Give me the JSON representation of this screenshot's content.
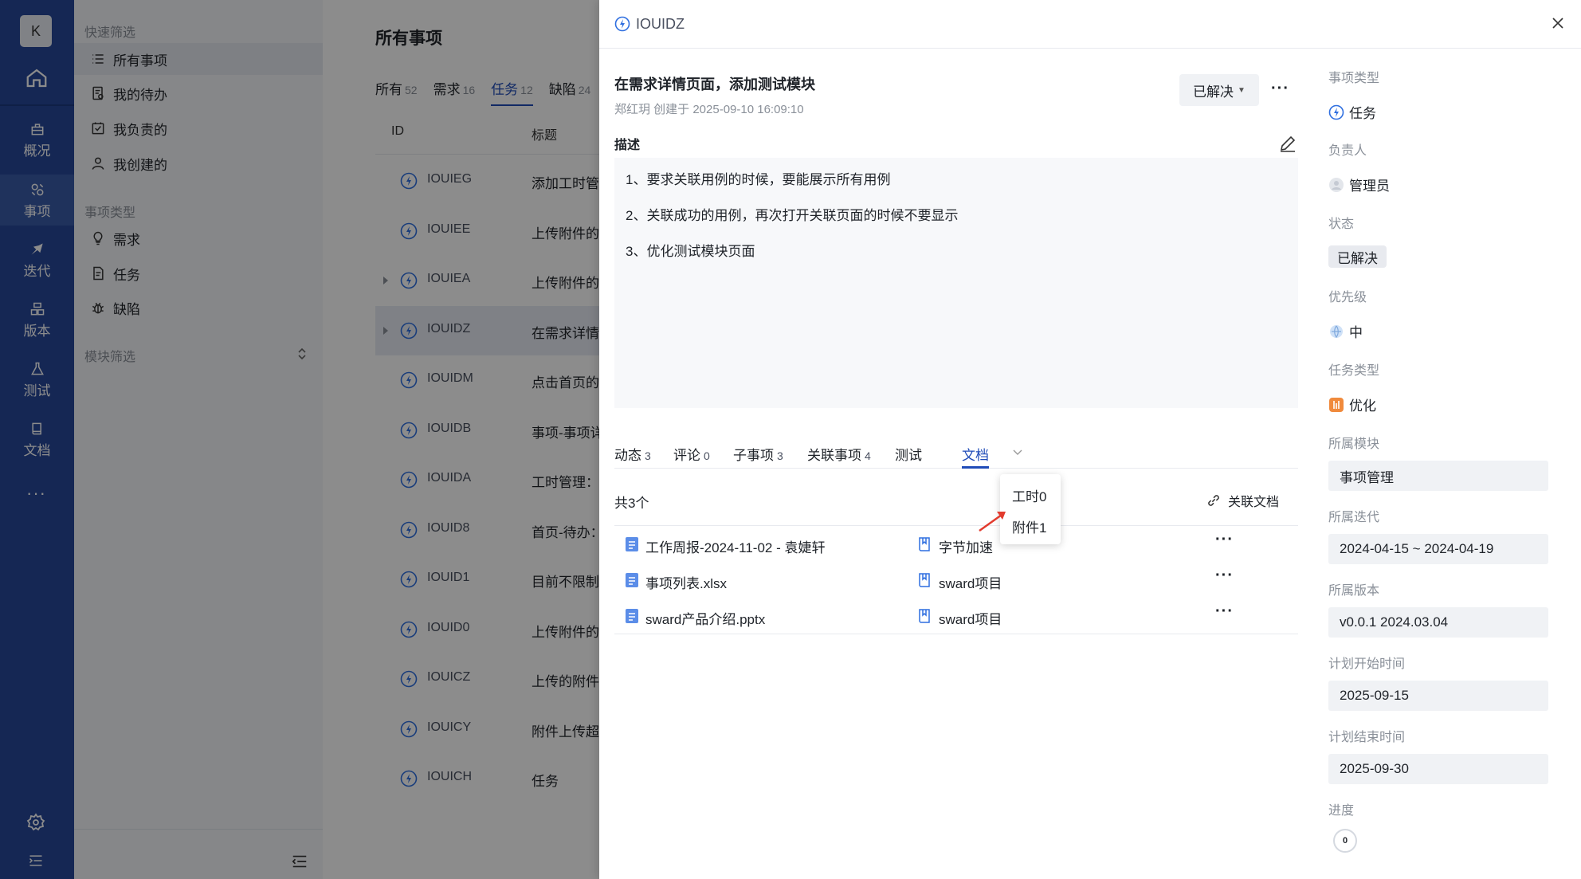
{
  "rail": {
    "avatar": "K",
    "items": [
      {
        "label": "概况",
        "icon": "overview-icon"
      },
      {
        "label": "事项",
        "icon": "workitem-icon"
      },
      {
        "label": "迭代",
        "icon": "sprint-icon"
      },
      {
        "label": "版本",
        "icon": "version-icon"
      },
      {
        "label": "测试",
        "icon": "test-icon"
      },
      {
        "label": "文档",
        "icon": "doc-icon"
      }
    ],
    "more": "···"
  },
  "sidebar": {
    "quick_filter_title": "快速筛选",
    "quick_filters": [
      "所有事项",
      "我的待办",
      "我负责的",
      "我创建的"
    ],
    "type_title": "事项类型",
    "types": [
      "需求",
      "任务",
      "缺陷"
    ],
    "module_title": "模块筛选"
  },
  "list": {
    "title": "所有事项",
    "tabs": [
      {
        "label": "所有",
        "count": "52"
      },
      {
        "label": "需求",
        "count": "16"
      },
      {
        "label": "任务",
        "count": "12"
      },
      {
        "label": "缺陷",
        "count": "24"
      }
    ],
    "columns": [
      "ID",
      "标题"
    ],
    "rows": [
      {
        "id": "IOUIEG",
        "title": "添加工时管理"
      },
      {
        "id": "IOUIEE",
        "title": "上传附件的大"
      },
      {
        "id": "IOUIEA",
        "title": "上传附件的大"
      },
      {
        "id": "IOUIDZ",
        "title": "在需求详情页"
      },
      {
        "id": "IOUIDM",
        "title": "点击首页的待"
      },
      {
        "id": "IOUIDB",
        "title": "事项-事项详"
      },
      {
        "id": "IOUIDA",
        "title": "工时管理：日"
      },
      {
        "id": "IOUID8",
        "title": "首页-待办："
      },
      {
        "id": "IOUID1",
        "title": "目前不限制附"
      },
      {
        "id": "IOUID0",
        "title": "上传附件的大"
      },
      {
        "id": "IOUICZ",
        "title": "上传的附件不"
      },
      {
        "id": "IOUICY",
        "title": "附件上传超时"
      },
      {
        "id": "IOUICH",
        "title": "任务"
      }
    ]
  },
  "drawer": {
    "id": "IOUIDZ",
    "title": "在需求详情页面，添加测试模块",
    "meta": "郑红玥 创建于 2025-09-10 16:09:10",
    "status": "已解决",
    "more": "···",
    "desc_label": "描述",
    "desc_lines": [
      "1、要求关联用例的时候，要能展示所有用例",
      "2、关联成功的用例，再次打开关联页面的时候不要显示",
      "3、优化测试模块页面"
    ],
    "tabs": [
      {
        "label": "动态",
        "count": "3"
      },
      {
        "label": "评论",
        "count": "0"
      },
      {
        "label": "子事项",
        "count": "3"
      },
      {
        "label": "关联事项",
        "count": "4"
      },
      {
        "label": "测试",
        "count": ""
      },
      {
        "label": "文档",
        "count": ""
      }
    ],
    "popup": [
      "工时0",
      "附件1"
    ],
    "doc_count": "共3个",
    "link_doc": "关联文档",
    "docs": [
      {
        "name": "工作周报-2024-11-02 - 袁婕轩",
        "project": "字节加速"
      },
      {
        "name": "事项列表.xlsx",
        "project": "sward项目"
      },
      {
        "name": "sward产品介绍.pptx",
        "project": "sward项目"
      }
    ]
  },
  "props": {
    "type_label": "事项类型",
    "type": "任务",
    "owner_label": "负责人",
    "owner": "管理员",
    "status_label": "状态",
    "status": "已解决",
    "priority_label": "优先级",
    "priority": "中",
    "task_type_label": "任务类型",
    "task_type": "优化",
    "module_label": "所属模块",
    "module": "事项管理",
    "sprint_label": "所属迭代",
    "sprint": "2024-04-15 ~ 2024-04-19",
    "version_label": "所属版本",
    "version": "v0.0.1 2024.03.04",
    "start_label": "计划开始时间",
    "start": "2025-09-15",
    "end_label": "计划结束时间",
    "end": "2025-09-30",
    "progress_label": "进度",
    "progress": "0"
  },
  "colors": {
    "rail": "#27489a",
    "accent": "#1f4bb8",
    "task_icon": "#2f6fe0",
    "arrow": "#e23b2e"
  }
}
